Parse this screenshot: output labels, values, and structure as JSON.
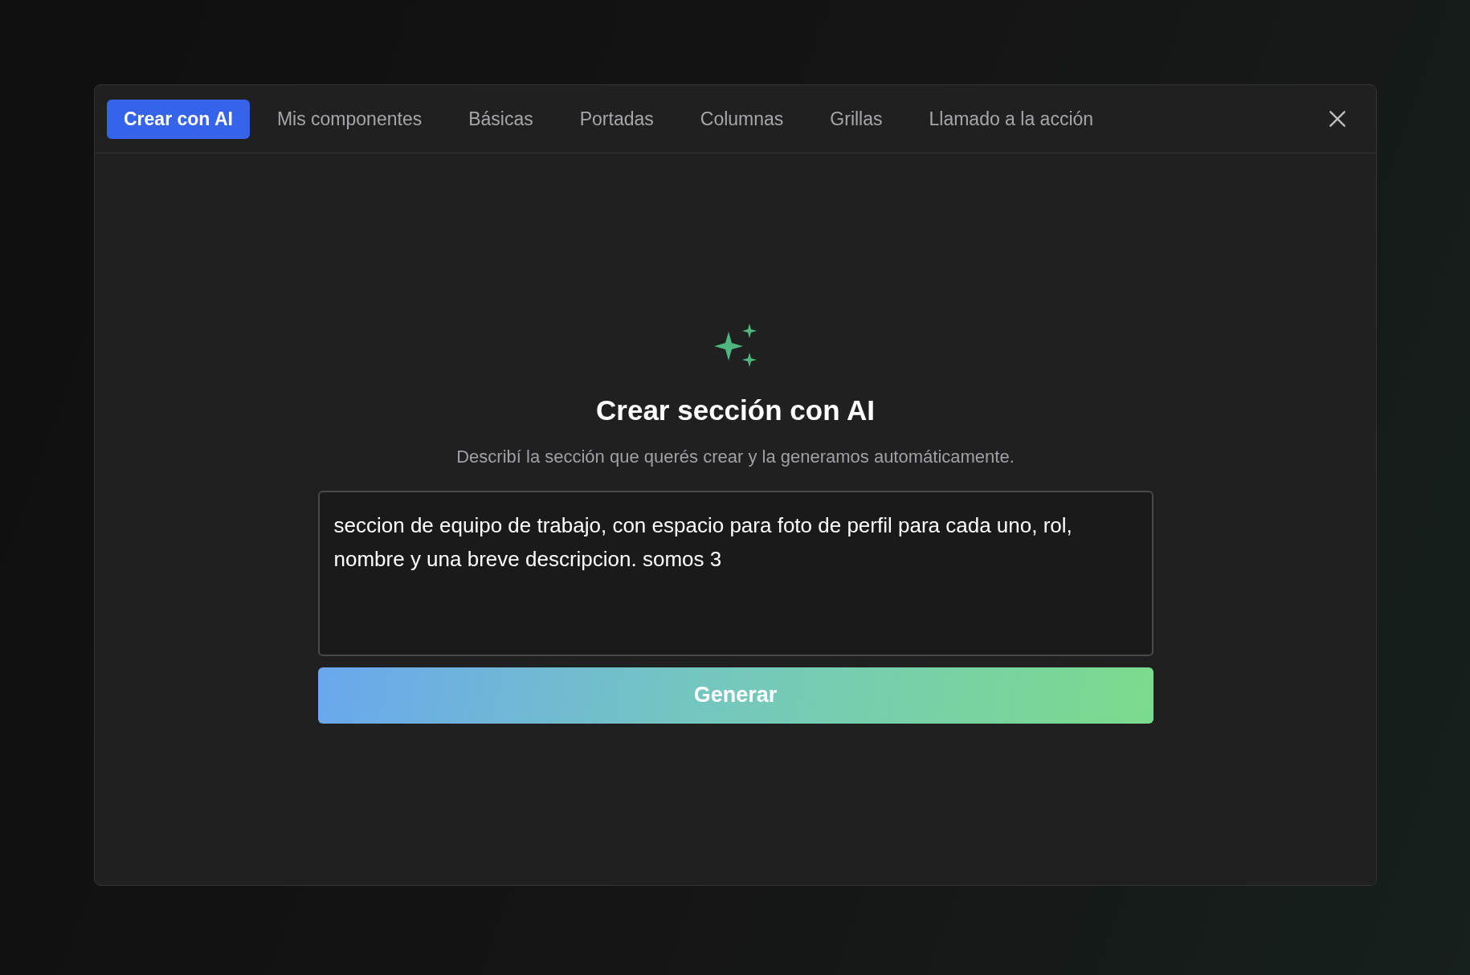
{
  "tabs": [
    {
      "label": "Crear con AI",
      "selected": true
    },
    {
      "label": "Mis componentes",
      "selected": false
    },
    {
      "label": "Básicas",
      "selected": false
    },
    {
      "label": "Portadas",
      "selected": false
    },
    {
      "label": "Columnas",
      "selected": false
    },
    {
      "label": "Grillas",
      "selected": false
    },
    {
      "label": "Llamado a la acción",
      "selected": false
    }
  ],
  "panel": {
    "title": "Crear sección con AI",
    "subtitle": "Describí la sección que querés crear y la generamos automáticamente.",
    "prompt": {
      "value": "seccion de equipo de trabajo, con espacio para foto de perfil para cada uno, rol, nombre y una breve descripcion. somos 3"
    },
    "button": "Generar"
  }
}
